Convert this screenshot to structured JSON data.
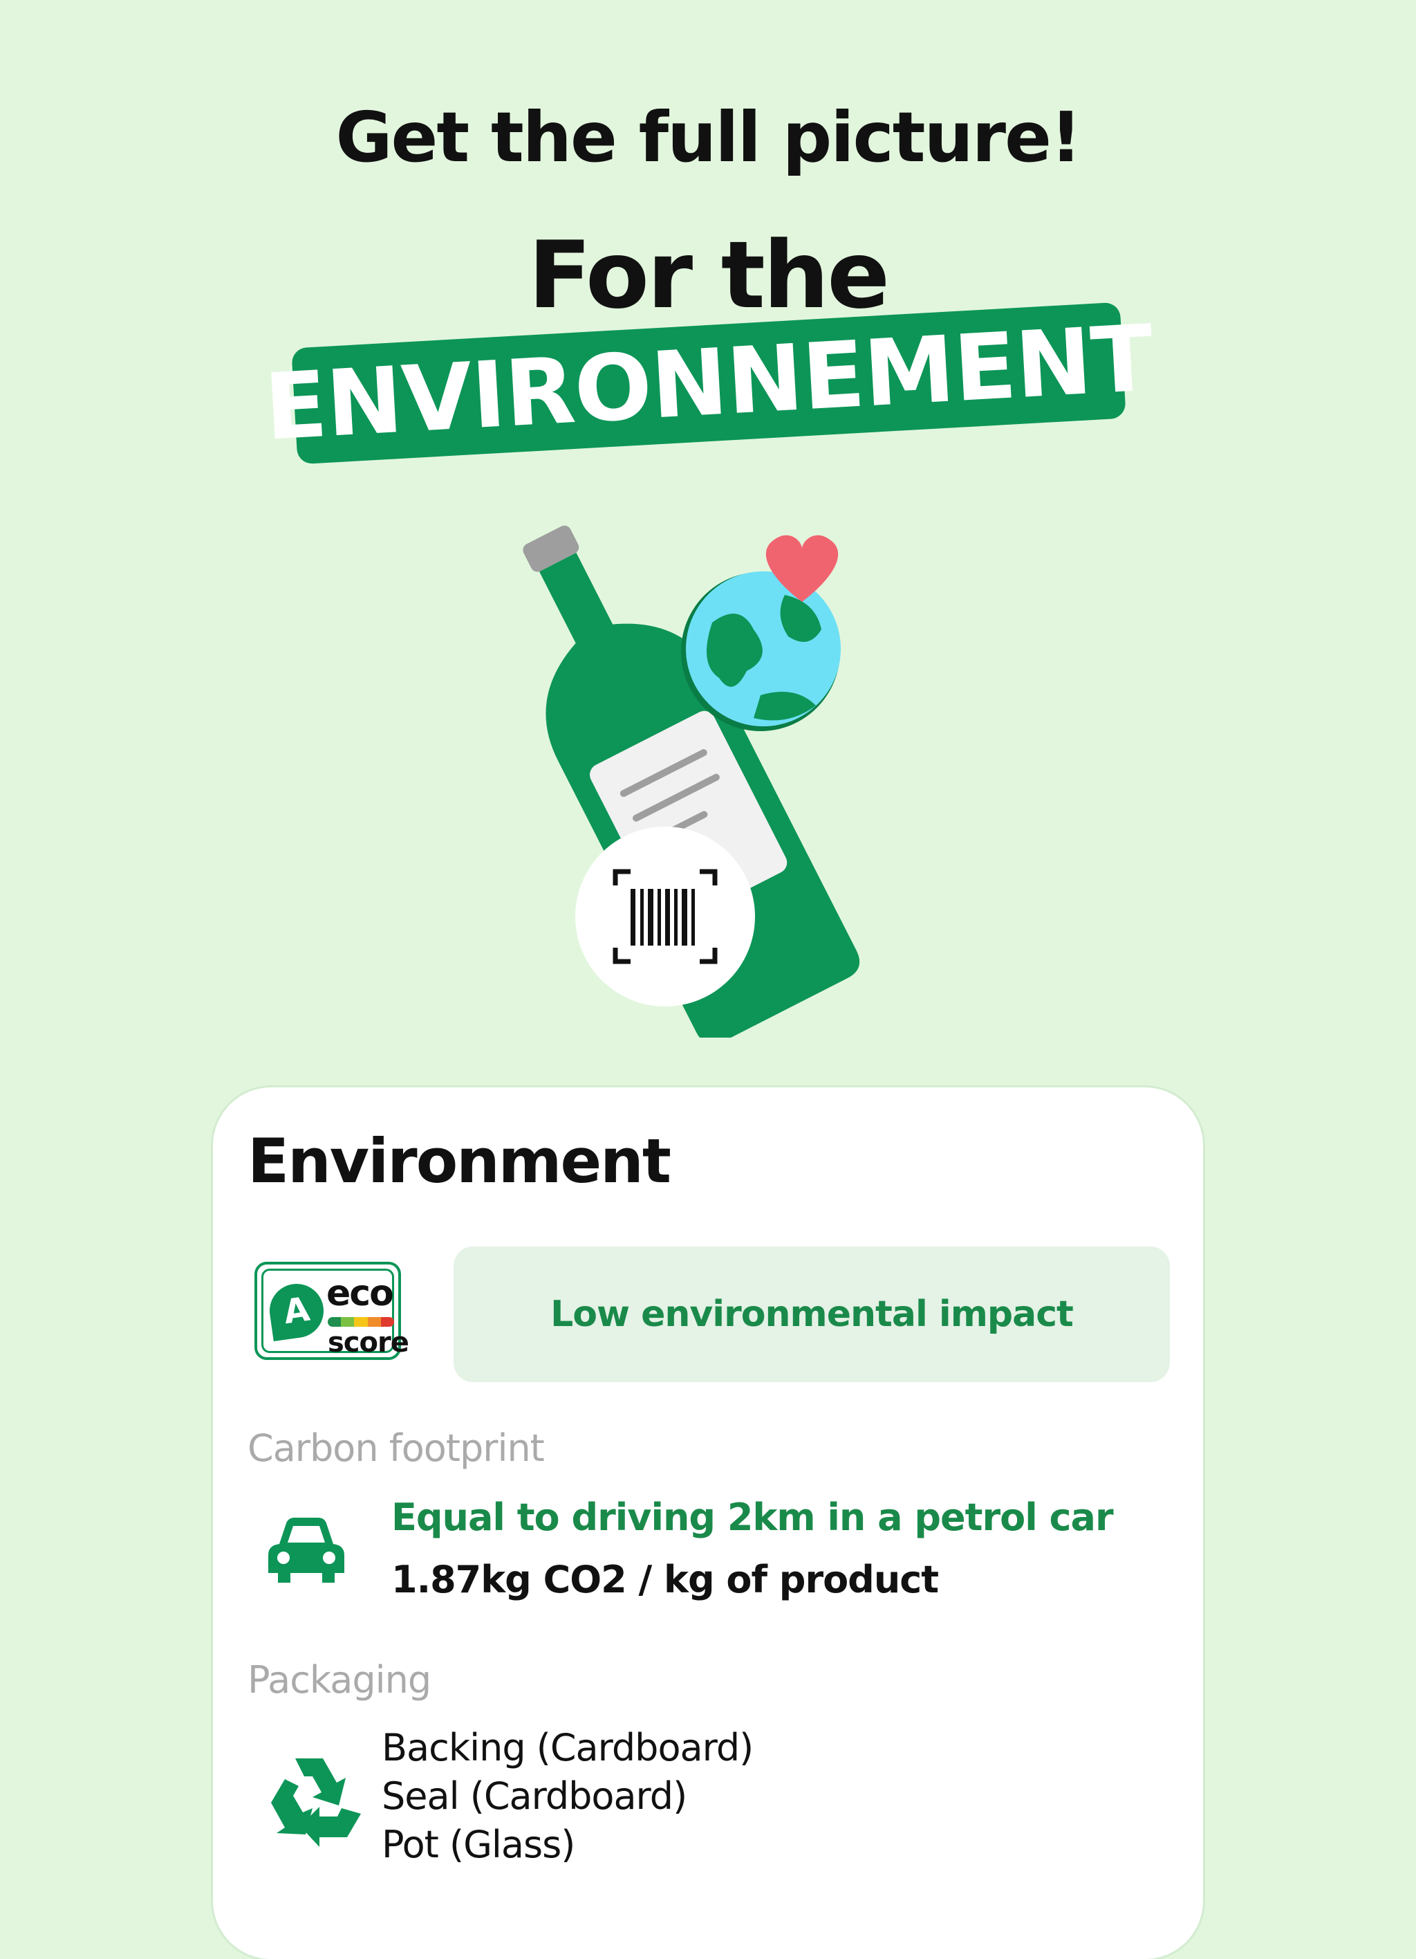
{
  "headline": "Get the full picture!",
  "subheadline": "For the",
  "banner": "ENVIRONNEMENT",
  "colors": {
    "background": "#e2f6dd",
    "brand_green": "#0c9557",
    "text_green": "#1a8a4a",
    "impact_bg": "#e5f2e6",
    "muted": "#aaaaaa"
  },
  "illustration": {
    "icons": [
      "bottle-icon",
      "globe-icon",
      "heart-icon",
      "barcode-scan-icon"
    ]
  },
  "card": {
    "title": "Environment",
    "eco_badge": {
      "grade": "A",
      "line1": "eco",
      "line2": "score",
      "scale_colors": [
        "#1e8f4e",
        "#7ac143",
        "#f5c518",
        "#f08c2a",
        "#e03a2f"
      ]
    },
    "impact_label": "Low environmental impact",
    "carbon": {
      "label": "Carbon footprint",
      "icon": "car-icon",
      "equivalent": "Equal to driving 2km in a petrol car",
      "value": "1.87kg CO2 / kg of product"
    },
    "packaging": {
      "label": "Packaging",
      "icon": "recycle-icon",
      "items": [
        "Backing (Cardboard)",
        "Seal (Cardboard)",
        "Pot (Glass)"
      ]
    }
  }
}
